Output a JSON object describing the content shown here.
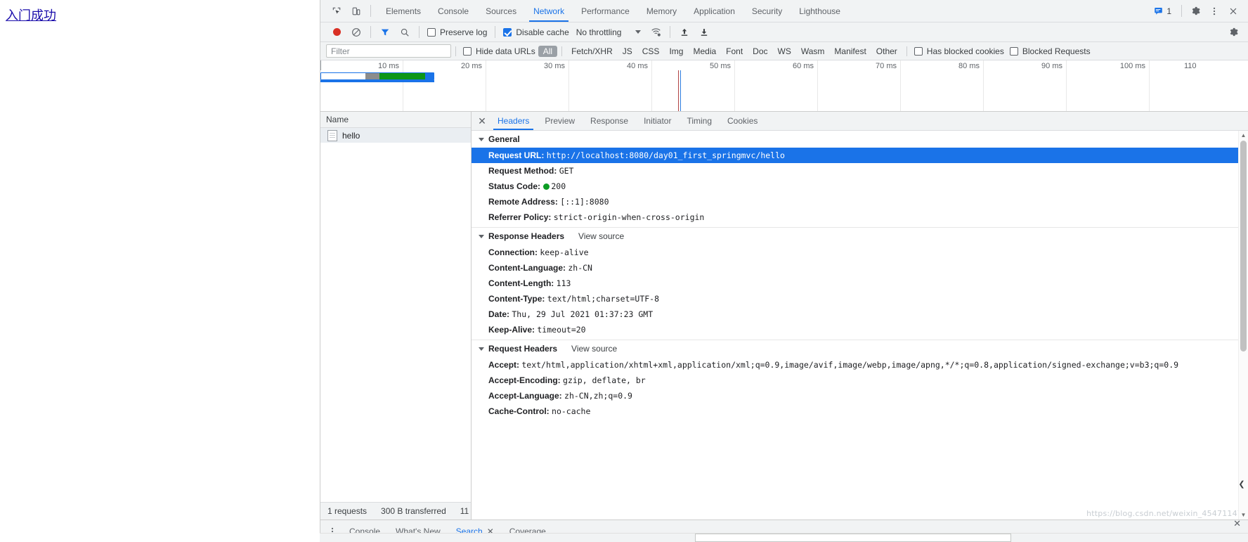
{
  "page": {
    "link_text": "入门成功"
  },
  "devtools": {
    "inspect_icon": "inspect-element-icon",
    "device_icon": "device-toolbar-icon",
    "tabs": [
      {
        "label": "Elements",
        "selected": false
      },
      {
        "label": "Console",
        "selected": false
      },
      {
        "label": "Sources",
        "selected": false
      },
      {
        "label": "Network",
        "selected": true
      },
      {
        "label": "Performance",
        "selected": false
      },
      {
        "label": "Memory",
        "selected": false
      },
      {
        "label": "Application",
        "selected": false
      },
      {
        "label": "Security",
        "selected": false
      },
      {
        "label": "Lighthouse",
        "selected": false
      }
    ],
    "message_count": "1",
    "settings_icon": "gear-icon",
    "more_icon": "more-vertical-icon",
    "close_icon": "close-icon"
  },
  "network_toolbar": {
    "record_icon": "record-stop-icon",
    "clear_icon": "clear-icon",
    "filter_icon": "filter-funnel-icon",
    "search_icon": "search-icon",
    "preserve_log": {
      "label": "Preserve log",
      "checked": false
    },
    "disable_cache": {
      "label": "Disable cache",
      "checked": true
    },
    "throttling": "No throttling",
    "wifi_icon": "network-conditions-icon",
    "import_icon": "import-har-icon",
    "export_icon": "export-har-icon",
    "settings_icon": "gear-icon"
  },
  "filter_bar": {
    "filter_placeholder": "Filter",
    "filter_value": "",
    "hide_data_urls": {
      "label": "Hide data URLs",
      "checked": false
    },
    "types": [
      {
        "label": "All",
        "selected": true
      },
      {
        "label": "Fetch/XHR",
        "selected": false
      },
      {
        "label": "JS",
        "selected": false
      },
      {
        "label": "CSS",
        "selected": false
      },
      {
        "label": "Img",
        "selected": false
      },
      {
        "label": "Media",
        "selected": false
      },
      {
        "label": "Font",
        "selected": false
      },
      {
        "label": "Doc",
        "selected": false
      },
      {
        "label": "WS",
        "selected": false
      },
      {
        "label": "Wasm",
        "selected": false
      },
      {
        "label": "Manifest",
        "selected": false
      },
      {
        "label": "Other",
        "selected": false
      }
    ],
    "has_blocked_cookies": {
      "label": "Has blocked cookies",
      "checked": false
    },
    "blocked_requests": {
      "label": "Blocked Requests",
      "checked": false
    }
  },
  "overview": {
    "ticks": [
      "10 ms",
      "20 ms",
      "30 ms",
      "40 ms",
      "50 ms",
      "60 ms",
      "70 ms",
      "80 ms",
      "90 ms",
      "100 ms",
      "110"
    ],
    "bar_color_wait": "#ffffff",
    "bar_color_stalled": "#8c8c8c",
    "bar_color_download": "#0d9618",
    "bar_color_outline": "#1a73e8",
    "dom_content_loaded_color": "#b24343",
    "load_event_color": "#2f7fe0"
  },
  "requests": {
    "column_name": "Name",
    "rows": [
      {
        "name": "hello",
        "icon": "document-icon",
        "selected": true
      }
    ]
  },
  "status_bar": {
    "requests": "1 requests",
    "transferred": "300 B transferred",
    "resources": "11"
  },
  "details": {
    "close_icon": "close-icon",
    "tabs": [
      {
        "label": "Headers",
        "selected": true
      },
      {
        "label": "Preview",
        "selected": false
      },
      {
        "label": "Response",
        "selected": false
      },
      {
        "label": "Initiator",
        "selected": false
      },
      {
        "label": "Timing",
        "selected": false
      },
      {
        "label": "Cookies",
        "selected": false
      }
    ],
    "sections": [
      {
        "title": "General",
        "view_source": "",
        "rows": [
          {
            "key": "Request URL:",
            "value": "http://localhost:8080/day01_first_springmvc/hello",
            "selected": true
          },
          {
            "key": "Request Method:",
            "value": "GET",
            "selected": false
          },
          {
            "key": "Status Code:",
            "value": "200",
            "status_dot": true,
            "selected": false
          },
          {
            "key": "Remote Address:",
            "value": "[::1]:8080",
            "selected": false
          },
          {
            "key": "Referrer Policy:",
            "value": "strict-origin-when-cross-origin",
            "selected": false
          }
        ]
      },
      {
        "title": "Response Headers",
        "view_source": "View source",
        "rows": [
          {
            "key": "Connection:",
            "value": "keep-alive",
            "selected": false
          },
          {
            "key": "Content-Language:",
            "value": "zh-CN",
            "selected": false
          },
          {
            "key": "Content-Length:",
            "value": "113",
            "selected": false
          },
          {
            "key": "Content-Type:",
            "value": "text/html;charset=UTF-8",
            "selected": false
          },
          {
            "key": "Date:",
            "value": "Thu, 29 Jul 2021 01:37:23 GMT",
            "selected": false
          },
          {
            "key": "Keep-Alive:",
            "value": "timeout=20",
            "selected": false
          }
        ]
      },
      {
        "title": "Request Headers",
        "view_source": "View source",
        "rows": [
          {
            "key": "Accept:",
            "value": "text/html,application/xhtml+xml,application/xml;q=0.9,image/avif,image/webp,image/apng,*/*;q=0.8,application/signed-exchange;v=b3;q=0.9",
            "selected": false
          },
          {
            "key": "Accept-Encoding:",
            "value": "gzip, deflate, br",
            "selected": false
          },
          {
            "key": "Accept-Language:",
            "value": "zh-CN,zh;q=0.9",
            "selected": false
          },
          {
            "key": "Cache-Control:",
            "value": "no-cache",
            "selected": false
          }
        ]
      }
    ],
    "watermark": "https://blog.csdn.net/weixin_45471147"
  },
  "drawer": {
    "more_icon": "more-vertical-icon",
    "tabs": [
      {
        "label": "Console",
        "selected": false,
        "closable": false
      },
      {
        "label": "What's New",
        "selected": false,
        "closable": false
      },
      {
        "label": "Search",
        "selected": true,
        "closable": true
      },
      {
        "label": "Coverage",
        "selected": false,
        "closable": false
      }
    ],
    "close_icon": "close-icon"
  }
}
